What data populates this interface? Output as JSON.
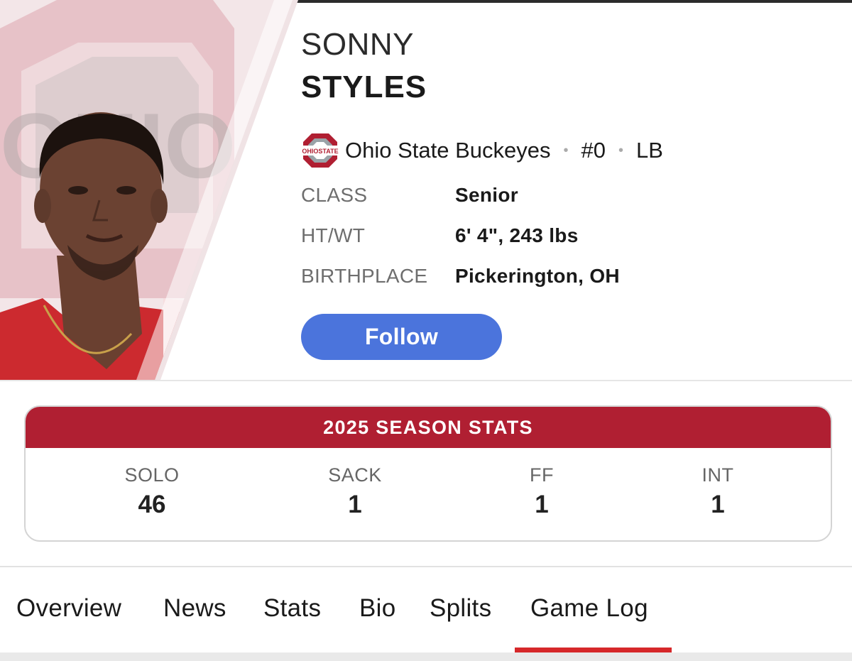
{
  "player": {
    "first_name": "SONNY",
    "last_name": "STYLES",
    "team": "Ohio State Buckeyes",
    "number": "#0",
    "position": "LB",
    "logo_text": "OHIO STATE"
  },
  "attributes": {
    "class_label": "CLASS",
    "class_value": "Senior",
    "htwt_label": "HT/WT",
    "htwt_value": "6' 4\", 243 lbs",
    "birthplace_label": "BIRTHPLACE",
    "birthplace_value": "Pickerington, OH"
  },
  "follow_label": "Follow",
  "season_stats": {
    "title": "2025 SEASON STATS",
    "stats": [
      {
        "label": "SOLO",
        "value": "46"
      },
      {
        "label": "SACK",
        "value": "1"
      },
      {
        "label": "FF",
        "value": "1"
      },
      {
        "label": "INT",
        "value": "1"
      }
    ]
  },
  "tabs": [
    {
      "label": "Overview"
    },
    {
      "label": "News"
    },
    {
      "label": "Stats"
    },
    {
      "label": "Bio"
    },
    {
      "label": "Splits"
    },
    {
      "label": "Game Log",
      "active": true
    }
  ],
  "colors": {
    "accent_blue": "#4b74dc",
    "scarlet": "#b01f32",
    "tab_indicator": "#d6282a"
  }
}
